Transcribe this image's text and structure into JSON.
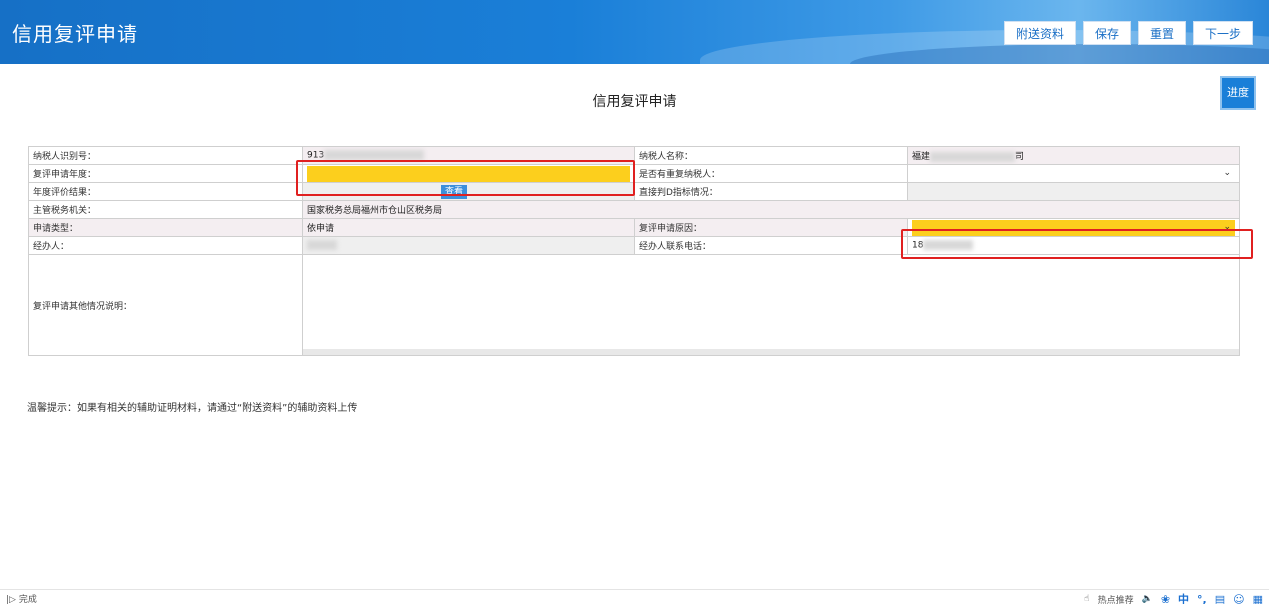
{
  "header": {
    "title": "信用复评申请",
    "buttons": {
      "attach": "附送资料",
      "save": "保存",
      "reset": "重置",
      "next": "下一步"
    }
  },
  "progress_label": "进度",
  "form": {
    "title": "信用复评申请",
    "taxpayer_id_label": "纳税人识别号：",
    "taxpayer_id_value": "913",
    "taxpayer_name_label": "纳税人名称：",
    "taxpayer_name_value_start": "福建",
    "taxpayer_name_value_end": "司",
    "review_year_label": "复评申请年度：",
    "repeat_taxpayer_label": "是否有重复纳税人：",
    "annual_result_label": "年度评价结果：",
    "view_button": "查看",
    "direct_d_label": "直接判D指标情况：",
    "tax_authority_label": "主管税务机关：",
    "tax_authority_value": "国家税务总局福州市仓山区税务局",
    "apply_type_label": "申请类型：",
    "apply_type_value": "依申请",
    "review_reason_label": "复评申请原因：",
    "handler_label": "经办人：",
    "handler_phone_label": "经办人联系电话：",
    "handler_phone_value": "18",
    "other_notes_label": "复评申请其他情况说明："
  },
  "tip": "温馨提示：如果有相关的辅助证明材料，请通过“附送资料”的辅助资料上传",
  "statusbar": {
    "status": "完成",
    "hot_recommend": "热点推荐",
    "ime_mode": "中"
  },
  "colors": {
    "highlight_yellow": "#fccf1d",
    "annotation_red": "#e02020",
    "header_blue": "#1a7fd8"
  }
}
